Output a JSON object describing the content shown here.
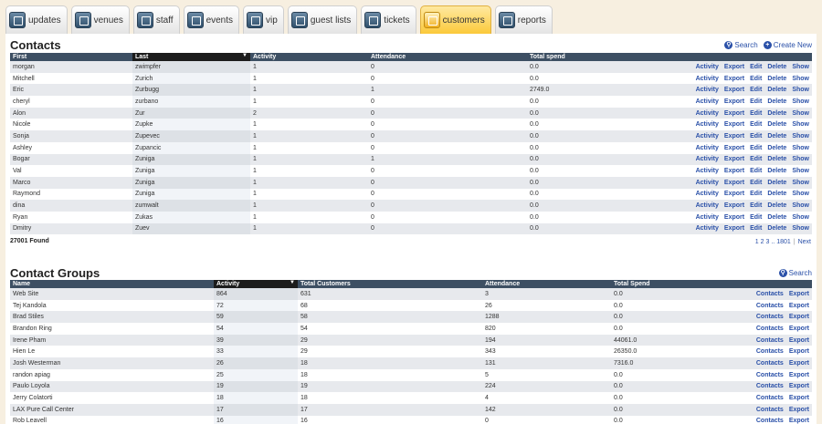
{
  "tabs": [
    {
      "label": "updates",
      "icon": "updates-icon"
    },
    {
      "label": "venues",
      "icon": "venues-icon"
    },
    {
      "label": "staff",
      "icon": "staff-icon"
    },
    {
      "label": "events",
      "icon": "events-icon"
    },
    {
      "label": "vip",
      "icon": "vip-icon"
    },
    {
      "label": "guest lists",
      "icon": "guest-lists-icon"
    },
    {
      "label": "tickets",
      "icon": "tickets-icon"
    },
    {
      "label": "customers",
      "icon": "customers-icon",
      "active": true
    },
    {
      "label": "reports",
      "icon": "reports-icon"
    }
  ],
  "contacts": {
    "title": "Contacts",
    "search_label": "Search",
    "create_label": "Create New",
    "columns": [
      "First",
      "Last",
      "Activity",
      "Attendance",
      "Total spend"
    ],
    "actions": [
      "Activity",
      "Export",
      "Edit",
      "Delete",
      "Show"
    ],
    "rows": [
      [
        "morgan",
        "zwimpfer",
        "1",
        "0",
        "0.0"
      ],
      [
        "Mitchell",
        "Zurich",
        "1",
        "0",
        "0.0"
      ],
      [
        "Eric",
        "Zurbugg",
        "1",
        "1",
        "2749.0"
      ],
      [
        "cheryl",
        "zurbano",
        "1",
        "0",
        "0.0"
      ],
      [
        "Alon",
        "Zur",
        "2",
        "0",
        "0.0"
      ],
      [
        "Nicole",
        "Zupke",
        "1",
        "0",
        "0.0"
      ],
      [
        "Sonja",
        "Zupevec",
        "1",
        "0",
        "0.0"
      ],
      [
        "Ashley",
        "Zupancic",
        "1",
        "0",
        "0.0"
      ],
      [
        "Bogar",
        "Zuniga",
        "1",
        "1",
        "0.0"
      ],
      [
        "Val",
        "Zuniga",
        "1",
        "0",
        "0.0"
      ],
      [
        "Marco",
        "Zuniga",
        "1",
        "0",
        "0.0"
      ],
      [
        "Raymond",
        "Zuniga",
        "1",
        "0",
        "0.0"
      ],
      [
        "dina",
        "zumwalt",
        "1",
        "0",
        "0.0"
      ],
      [
        "Ryan",
        "Zukas",
        "1",
        "0",
        "0.0"
      ],
      [
        "Dmitry",
        "Zuev",
        "1",
        "0",
        "0.0"
      ]
    ],
    "found": "27001 Found",
    "pager": {
      "p1": "1",
      "p2": "2",
      "p3": "3",
      "ellipsis": "..",
      "last": "1801",
      "next": "Next"
    }
  },
  "groups": {
    "title": "Contact Groups",
    "search_label": "Search",
    "columns": [
      "Name",
      "Activity",
      "Total Customers",
      "Attendance",
      "Total Spend"
    ],
    "actions": [
      "Contacts",
      "Export"
    ],
    "rows": [
      [
        "Web Site",
        "864",
        "631",
        "3",
        "0.0"
      ],
      [
        "Tej Kandola",
        "72",
        "68",
        "26",
        "0.0"
      ],
      [
        "Brad Stiles",
        "59",
        "58",
        "1288",
        "0.0"
      ],
      [
        "Brandon Ring",
        "54",
        "54",
        "820",
        "0.0"
      ],
      [
        "Irene Pham",
        "39",
        "29",
        "194",
        "44061.0"
      ],
      [
        "Hien Le",
        "33",
        "29",
        "343",
        "26350.0"
      ],
      [
        "Josh Westerman",
        "26",
        "18",
        "131",
        "7316.0"
      ],
      [
        "randon apiag",
        "25",
        "18",
        "5",
        "0.0"
      ],
      [
        "Paulo Loyola",
        "19",
        "19",
        "224",
        "0.0"
      ],
      [
        "Jerry Colatorti",
        "18",
        "18",
        "4",
        "0.0"
      ],
      [
        "LAX Pure Call Center",
        "17",
        "17",
        "142",
        "0.0"
      ],
      [
        "Rob Leavell",
        "16",
        "16",
        "0",
        "0.0"
      ]
    ]
  }
}
